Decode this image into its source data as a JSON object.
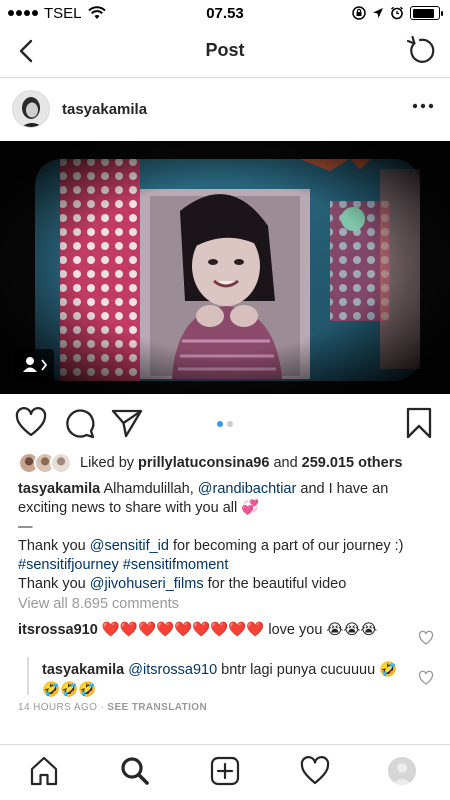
{
  "status": {
    "carrier": "TSEL",
    "time": "07.53",
    "battery_level": 0.85
  },
  "nav": {
    "title": "Post"
  },
  "post": {
    "username": "tasyakamila",
    "carousel": {
      "count": 2,
      "active": 0
    },
    "likes": {
      "prefix": "Liked by",
      "user": "prillylatuconsina96",
      "and": "and",
      "count": "259.015 others"
    },
    "caption": {
      "user": "tasyakamila",
      "line1_a": "Alhamdulillah,",
      "line1_mention": "@randibachtiar",
      "line1_b": "and I have an exciting news to share with you all",
      "emoji_1": "💞",
      "dash": "—",
      "line2_a": "Thank you",
      "line2_mention": "@sensitif_id",
      "line2_b": "for becoming a part of our journey :)",
      "hashtags": "#sensitifjourney #sensitifmoment",
      "line3_a": "Thank you",
      "line3_mention": "@jivohuseri_films",
      "line3_b": "for the beautiful video"
    },
    "view_all": "View all 8.695 comments",
    "comments": [
      {
        "user": "itsrossa910",
        "hearts": "❤️❤️❤️❤️❤️❤️❤️❤️❤️",
        "text": "love you",
        "emoji": "😭😭😭"
      },
      {
        "user": "tasyakamila",
        "mention": "@itsrossa910",
        "text": "bntr lagi punya cucuuuu",
        "emoji": "🤣🤣🤣🤣"
      }
    ],
    "time_ago": "14 HOURS AGO",
    "translate": "SEE TRANSLATION"
  }
}
